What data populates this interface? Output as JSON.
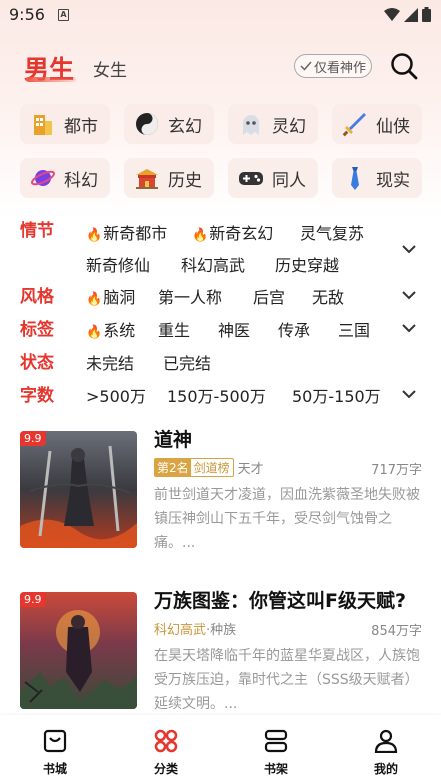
{
  "status_bar": {
    "time": "9:56",
    "notif_icon": "A"
  },
  "header": {
    "tab_male": "男生",
    "tab_female": "女生",
    "only_classic": "仅看神作",
    "accent": "#e6372f"
  },
  "categories": [
    {
      "label": "都市",
      "icon": "building-icon"
    },
    {
      "label": "玄幻",
      "icon": "yin-yang-icon"
    },
    {
      "label": "灵幻",
      "icon": "ghost-icon"
    },
    {
      "label": "仙侠",
      "icon": "sword-icon"
    },
    {
      "label": "科幻",
      "icon": "planet-icon"
    },
    {
      "label": "历史",
      "icon": "palace-icon"
    },
    {
      "label": "同人",
      "icon": "gamepad-icon"
    },
    {
      "label": "现实",
      "icon": "tie-icon"
    }
  ],
  "filters": {
    "plot": {
      "title": "情节",
      "options": [
        "新奇都市",
        "新奇玄幻",
        "灵气复苏",
        "新奇修仙",
        "科幻高武",
        "历史穿越"
      ]
    },
    "style": {
      "title": "风格",
      "options": [
        "脑洞",
        "第一人称",
        "后宫",
        "无敌"
      ]
    },
    "tags": {
      "title": "标签",
      "options": [
        "系统",
        "重生",
        "神医",
        "传承",
        "三国"
      ]
    },
    "status": {
      "title": "状态",
      "options": [
        "未完结",
        "已完结"
      ]
    },
    "words": {
      "title": "字数",
      "options": [
        ">500万",
        "150万-500万",
        "50万-150万"
      ]
    }
  },
  "books": [
    {
      "rating": "9.9",
      "title": "道神",
      "rank_no": "第2名",
      "rank_list": "剑道榜",
      "genre": "天才",
      "words": "717万字",
      "desc": "前世剑道天才凌道，因血洗紫薇圣地失败被镇压神剑山下五千年，受尽剑气蚀骨之痛。..."
    },
    {
      "rating": "9.9",
      "title": "万族图鉴：你管这叫F级天赋?",
      "genre": "科幻高武",
      "genre_sep": "·",
      "genre2": "种族",
      "words": "854万字",
      "desc": "在昊天塔降临千年的蓝星华夏战区，人族饱受万族压迫，靠时代之主（SSS级天赋者）延续文明。..."
    }
  ],
  "bottom_nav": [
    {
      "label": "书城",
      "icon": "store-icon"
    },
    {
      "label": "分类",
      "icon": "category-icon",
      "active": true
    },
    {
      "label": "书架",
      "icon": "shelf-icon"
    },
    {
      "label": "我的",
      "icon": "profile-icon"
    }
  ]
}
